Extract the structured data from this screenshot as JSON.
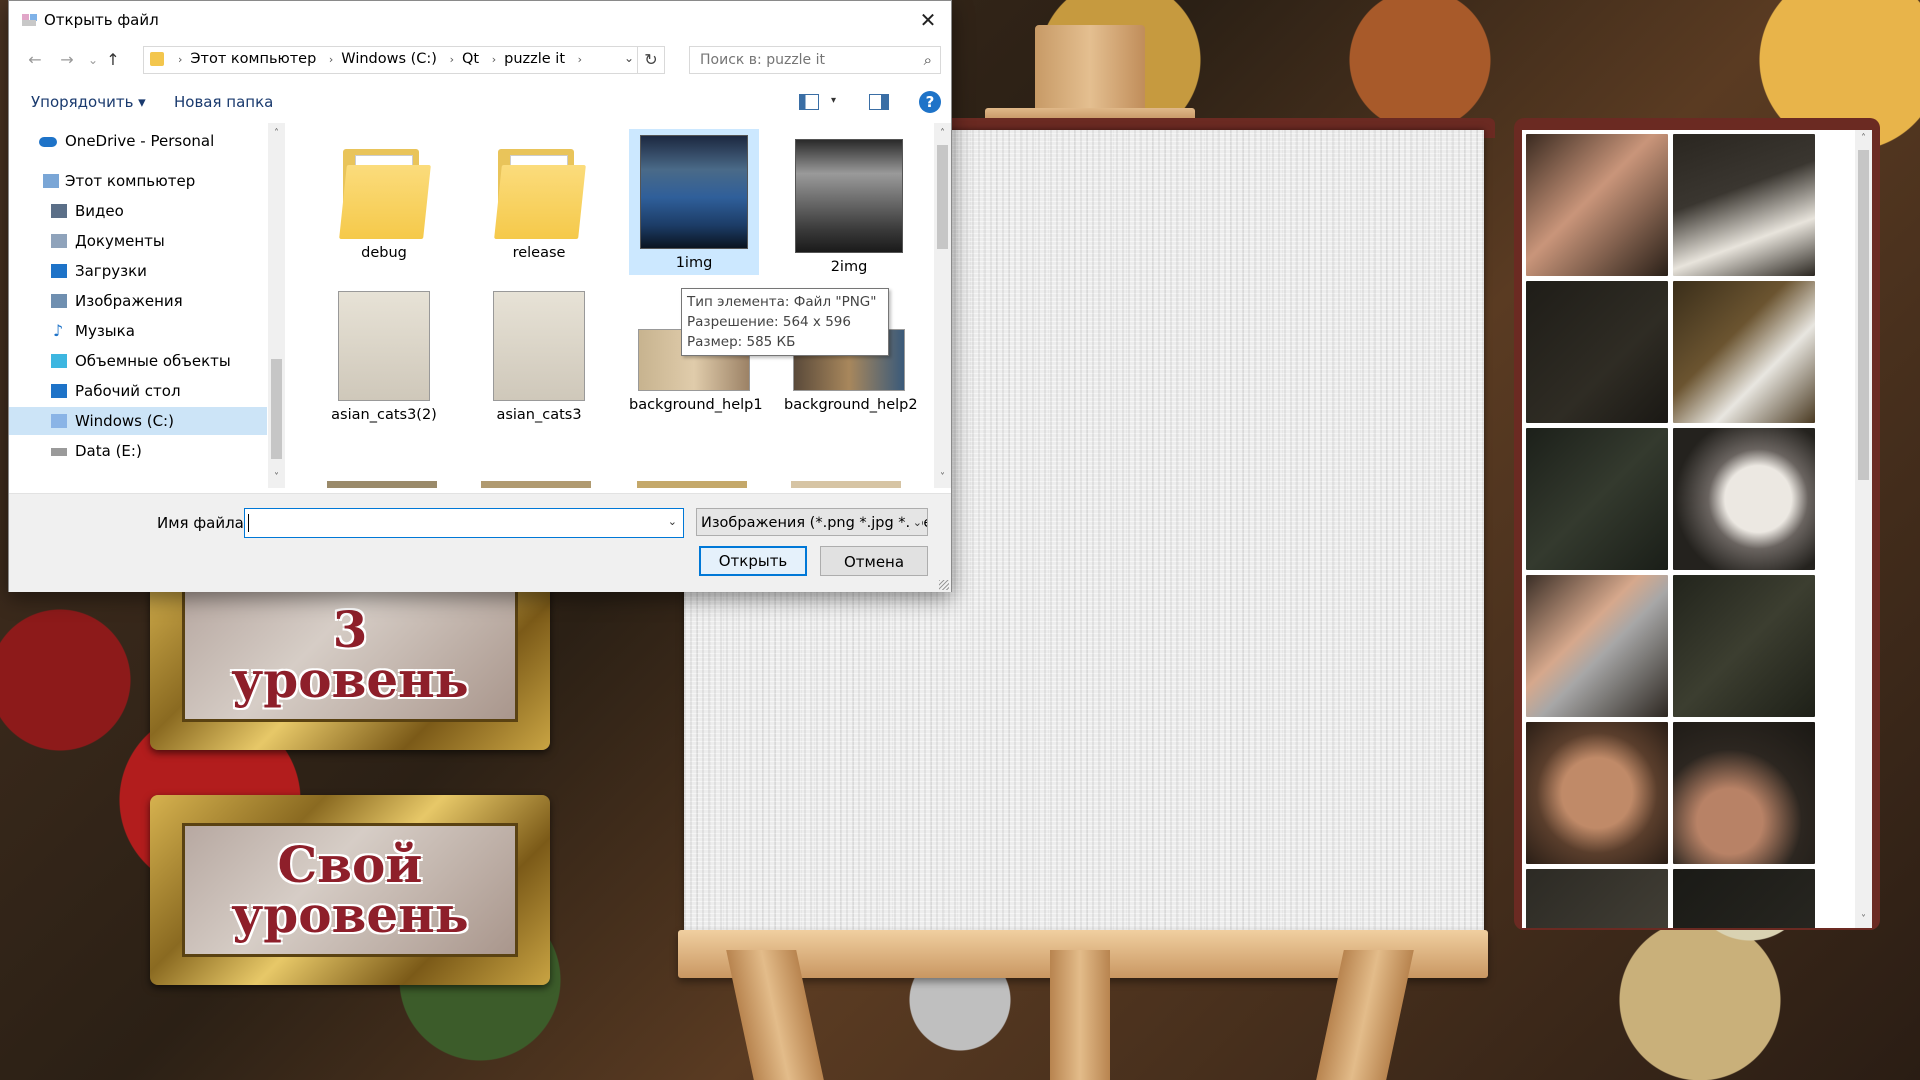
{
  "dialog": {
    "title": "Открыть файл",
    "close_glyph": "✕",
    "nav": {
      "back_glyph": "←",
      "forward_glyph": "→",
      "recent_glyph": "⌄",
      "up_glyph": "↑",
      "breadcrumbs": [
        "Этот компьютер",
        "Windows (C:)",
        "Qt",
        "puzzle it"
      ],
      "separator_glyph": "›",
      "dropdown_glyph": "⌄",
      "refresh_glyph": "↻"
    },
    "search": {
      "placeholder": "Поиск в: puzzle it",
      "icon_glyph": "⌕"
    },
    "toolbar": {
      "organize_label": "Упорядочить ▾",
      "new_folder_label": "Новая папка",
      "help_glyph": "?",
      "view_dropdown_glyph": "▾"
    },
    "nav_pane": {
      "items": [
        {
          "label": "OneDrive - Personal",
          "icon": "cloud-icon"
        },
        {
          "label": "Этот компьютер",
          "icon": "computer-icon"
        },
        {
          "label": "Видео",
          "icon": "video-icon"
        },
        {
          "label": "Документы",
          "icon": "documents-icon"
        },
        {
          "label": "Загрузки",
          "icon": "downloads-icon"
        },
        {
          "label": "Изображения",
          "icon": "pictures-icon"
        },
        {
          "label": "Музыка",
          "icon": "music-icon"
        },
        {
          "label": "Объемные объекты",
          "icon": "3d-objects-icon"
        },
        {
          "label": "Рабочий стол",
          "icon": "desktop-icon"
        },
        {
          "label": "Windows (C:)",
          "icon": "drive-icon",
          "selected": true
        },
        {
          "label": "Data (E:)",
          "icon": "drive-icon"
        }
      ],
      "scroll_up_glyph": "˄",
      "scroll_down_glyph": "˅",
      "music_glyph": "♪"
    },
    "files": [
      {
        "name": "debug",
        "type": "folder"
      },
      {
        "name": "release",
        "type": "folder"
      },
      {
        "name": "1img",
        "type": "image",
        "selected": true
      },
      {
        "name": "2img",
        "type": "image"
      },
      {
        "name": "asian_cats3(2)",
        "type": "image"
      },
      {
        "name": "asian_cats3",
        "type": "image"
      },
      {
        "name": "background_help1",
        "type": "image"
      },
      {
        "name": "background_help2",
        "type": "image"
      }
    ],
    "tooltip": {
      "type_line": "Тип элемента: Файл \"PNG\"",
      "resolution_line": "Разрешение: 564 x 596",
      "size_line": "Размер: 585 КБ"
    },
    "filename_label": "Имя файла:",
    "filename_value": "",
    "filter_value": "Изображения (*.png *.jpg *.jpe",
    "open_label": "Открыть",
    "cancel_label": "Отмена"
  },
  "game": {
    "level_buttons": [
      {
        "label": "3\nуровень"
      },
      {
        "label": "Свой\nуровень"
      }
    ],
    "pieces_count_visible": 12,
    "colors": {
      "frame": "#6b2a22",
      "level_text": "#8e1f2a"
    }
  }
}
